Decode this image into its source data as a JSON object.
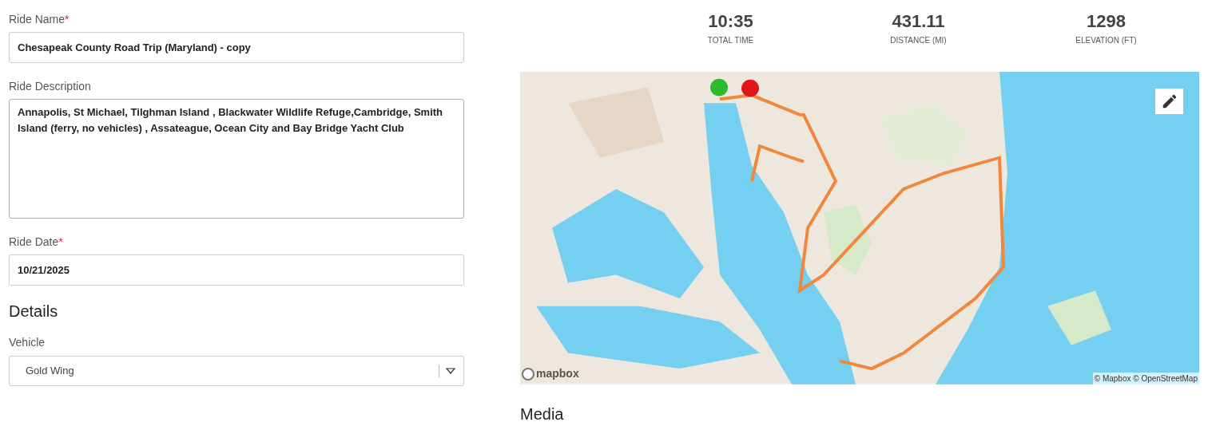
{
  "form": {
    "fields": [
      {
        "kind": "text",
        "label": "Ride Name",
        "required_mark": "*",
        "value": "Chesapeak County Road Trip (Maryland) - copy"
      },
      {
        "kind": "textarea",
        "label": "Ride Description",
        "value": "Annapolis, St Michael, Tilghman Island , Blackwater Wildlife Refuge,Cambridge, Smith Island (ferry, no vehicles) , Assateague, Ocean City and Bay Bridge Yacht Club"
      },
      {
        "kind": "text",
        "label": "Ride Date",
        "required_mark": "*",
        "value": "10/21/2025"
      }
    ],
    "details_heading": "Details",
    "vehicle": {
      "label": "Vehicle",
      "value": "Gold Wing"
    }
  },
  "stats": [
    {
      "value": "10:35",
      "label": "TOTAL TIME"
    },
    {
      "value": "431.11",
      "label": "DISTANCE (MI)"
    },
    {
      "value": "1298",
      "label": "ELEVATION (FT)"
    }
  ],
  "map": {
    "logo": "mapbox",
    "attribution": "© Mapbox © OpenStreetMap"
  },
  "media_heading": "Media"
}
